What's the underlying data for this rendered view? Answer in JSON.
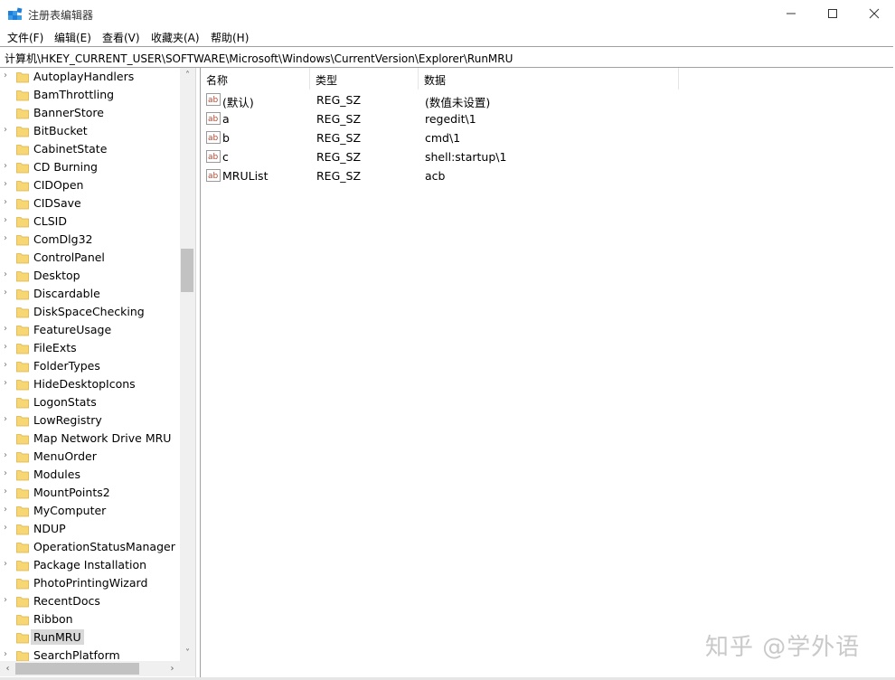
{
  "window": {
    "title": "注册表编辑器",
    "controls": {
      "minimize": "minimize-icon",
      "maximize": "maximize-icon",
      "close": "close-icon"
    }
  },
  "menu": [
    "文件(F)",
    "编辑(E)",
    "查看(V)",
    "收藏夹(A)",
    "帮助(H)"
  ],
  "address": "计算机\\HKEY_CURRENT_USER\\SOFTWARE\\Microsoft\\Windows\\CurrentVersion\\Explorer\\RunMRU",
  "tree": {
    "items": [
      {
        "label": "AutoplayHandlers",
        "expandable": true
      },
      {
        "label": "BamThrottling",
        "expandable": false
      },
      {
        "label": "BannerStore",
        "expandable": false
      },
      {
        "label": "BitBucket",
        "expandable": true
      },
      {
        "label": "CabinetState",
        "expandable": false
      },
      {
        "label": "CD Burning",
        "expandable": true
      },
      {
        "label": "CIDOpen",
        "expandable": true
      },
      {
        "label": "CIDSave",
        "expandable": true
      },
      {
        "label": "CLSID",
        "expandable": true
      },
      {
        "label": "ComDlg32",
        "expandable": true
      },
      {
        "label": "ControlPanel",
        "expandable": false
      },
      {
        "label": "Desktop",
        "expandable": true
      },
      {
        "label": "Discardable",
        "expandable": true
      },
      {
        "label": "DiskSpaceChecking",
        "expandable": false
      },
      {
        "label": "FeatureUsage",
        "expandable": true
      },
      {
        "label": "FileExts",
        "expandable": true
      },
      {
        "label": "FolderTypes",
        "expandable": true
      },
      {
        "label": "HideDesktopIcons",
        "expandable": true
      },
      {
        "label": "LogonStats",
        "expandable": false
      },
      {
        "label": "LowRegistry",
        "expandable": true
      },
      {
        "label": "Map Network Drive MRU",
        "expandable": false
      },
      {
        "label": "MenuOrder",
        "expandable": true
      },
      {
        "label": "Modules",
        "expandable": true
      },
      {
        "label": "MountPoints2",
        "expandable": true
      },
      {
        "label": "MyComputer",
        "expandable": true
      },
      {
        "label": "NDUP",
        "expandable": true
      },
      {
        "label": "OperationStatusManager",
        "expandable": false
      },
      {
        "label": "Package Installation",
        "expandable": true
      },
      {
        "label": "PhotoPrintingWizard",
        "expandable": false
      },
      {
        "label": "RecentDocs",
        "expandable": true
      },
      {
        "label": "Ribbon",
        "expandable": false
      },
      {
        "label": "RunMRU",
        "expandable": false,
        "selected": true
      },
      {
        "label": "SearchPlatform",
        "expandable": true
      }
    ]
  },
  "list": {
    "columns": [
      "名称",
      "类型",
      "数据"
    ],
    "rows": [
      {
        "name": "(默认)",
        "type": "REG_SZ",
        "data": "(数值未设置)"
      },
      {
        "name": "a",
        "type": "REG_SZ",
        "data": "regedit\\1"
      },
      {
        "name": "b",
        "type": "REG_SZ",
        "data": "cmd\\1"
      },
      {
        "name": "c",
        "type": "REG_SZ",
        "data": "shell:startup\\1"
      },
      {
        "name": "MRUList",
        "type": "REG_SZ",
        "data": "acb"
      }
    ]
  },
  "watermark": "知乎 @学外语",
  "colors": {
    "folder": "#f7d674",
    "selection": "#d9d9d9",
    "scrollbar": "#f0f0f0",
    "thumb": "#c2c2c2",
    "ab_icon": "#b5462f"
  }
}
